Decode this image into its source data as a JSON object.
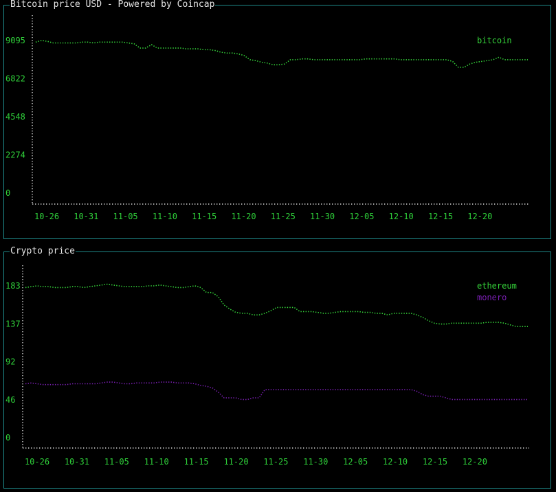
{
  "colors": {
    "border": "#1f8b8b",
    "axis": "#d8d8d8",
    "label": "#2fd13a",
    "bitcoin": "#35d43a",
    "ethereum": "#35d43a",
    "monero": "#7a1fb3"
  },
  "panels": {
    "bitcoin_title": "Bitcoin price USD - Powered by Coincap",
    "crypto_title": "Crypto price"
  },
  "chart_data": [
    {
      "type": "line",
      "title": "Bitcoin price USD - Powered by Coincap",
      "ylim": [
        0,
        9095
      ],
      "yticks": [
        "9095",
        "6822",
        "4548",
        "2274",
        "0"
      ],
      "xticks": [
        "10-26",
        "10-31",
        "11-05",
        "11-10",
        "11-15",
        "11-20",
        "11-25",
        "11-30",
        "12-05",
        "12-10",
        "12-15",
        "12-20"
      ],
      "x_start": "10-24",
      "x_end": "12-24",
      "legend_position": "top-right",
      "series": [
        {
          "name": "bitcoin",
          "color": "#35d43a",
          "values": [
            9000,
            9100,
            9050,
            8950,
            8950,
            8950,
            8950,
            8950,
            9000,
            9000,
            8950,
            9000,
            9000,
            9000,
            9000,
            9000,
            8950,
            8900,
            8650,
            8650,
            8850,
            8650,
            8650,
            8650,
            8650,
            8650,
            8600,
            8600,
            8600,
            8550,
            8550,
            8500,
            8400,
            8350,
            8350,
            8300,
            8200,
            7950,
            7900,
            7800,
            7750,
            7650,
            7650,
            7700,
            7950,
            7950,
            8000,
            8000,
            7950,
            7950,
            7950,
            7950,
            7950,
            7950,
            7950,
            7950,
            7950,
            8000,
            8000,
            8000,
            8000,
            8000,
            8000,
            7950,
            7950,
            7950,
            7950,
            7950,
            7950,
            7950,
            7950,
            7950,
            7850,
            7500,
            7500,
            7700,
            7800,
            7850,
            7900,
            7950,
            8100,
            7950,
            7950,
            7950,
            7950,
            7950
          ]
        }
      ]
    },
    {
      "type": "line",
      "title": "Crypto price",
      "ylim": [
        0,
        183
      ],
      "yticks": [
        "183",
        "137",
        "92",
        "46",
        "0"
      ],
      "xticks": [
        "10-26",
        "10-31",
        "11-05",
        "11-10",
        "11-15",
        "11-20",
        "11-25",
        "11-30",
        "12-05",
        "12-10",
        "12-15",
        "12-20"
      ],
      "x_start": "10-24",
      "x_end": "12-24",
      "legend_position": "top-right",
      "series": [
        {
          "name": "ethereum",
          "color": "#35d43a",
          "values": [
            181,
            182,
            183,
            182,
            182,
            181,
            181,
            181,
            182,
            182,
            181,
            182,
            183,
            184,
            185,
            184,
            183,
            182,
            182,
            182,
            182,
            183,
            183,
            184,
            183,
            182,
            181,
            181,
            182,
            183,
            181,
            175,
            175,
            170,
            160,
            155,
            151,
            150,
            150,
            148,
            148,
            150,
            153,
            157,
            157,
            157,
            157,
            152,
            152,
            152,
            151,
            150,
            150,
            151,
            152,
            152,
            152,
            152,
            151,
            151,
            150,
            150,
            148,
            150,
            150,
            150,
            150,
            148,
            145,
            141,
            138,
            137,
            137,
            138,
            138,
            138,
            138,
            138,
            138,
            139,
            139,
            139,
            138,
            136,
            134,
            134,
            134
          ]
        },
        {
          "name": "monero",
          "color": "#7a1fb3",
          "values": [
            65,
            66,
            65,
            64,
            64,
            64,
            64,
            64,
            65,
            65,
            65,
            65,
            65,
            66,
            67,
            67,
            66,
            65,
            65,
            66,
            66,
            66,
            66,
            67,
            67,
            67,
            66,
            66,
            66,
            65,
            63,
            62,
            60,
            55,
            48,
            48,
            48,
            46,
            46,
            48,
            48,
            58,
            58,
            58,
            58,
            58,
            58,
            58,
            58,
            58,
            58,
            58,
            58,
            58,
            58,
            58,
            58,
            58,
            58,
            58,
            58,
            58,
            58,
            58,
            58,
            58,
            58,
            56,
            52,
            50,
            50,
            50,
            48,
            46,
            46,
            46,
            46,
            46,
            46,
            46,
            46,
            46,
            46,
            46,
            46,
            46,
            46
          ]
        }
      ]
    }
  ]
}
